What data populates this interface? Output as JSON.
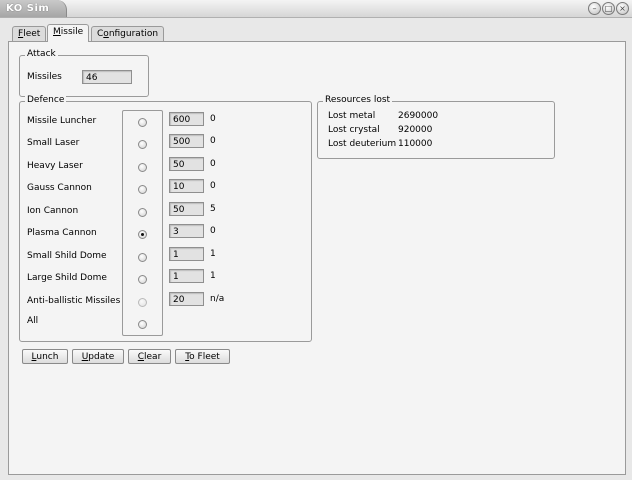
{
  "window": {
    "title": "KO Sim",
    "controls": [
      "minimize-icon",
      "maximize-icon",
      "close-icon"
    ]
  },
  "tabs": [
    {
      "label": "Fleet",
      "mnemonic": "F"
    },
    {
      "label": "Missile",
      "mnemonic": "M",
      "active": true
    },
    {
      "label": "Configuration",
      "mnemonic": "o"
    }
  ],
  "attack": {
    "legend": "Attack",
    "missiles_label": "Missiles",
    "missiles_value": "46"
  },
  "defence": {
    "legend": "Defence",
    "rows": [
      {
        "label": "Missile Luncher",
        "value": "600",
        "result": "0",
        "selected": false
      },
      {
        "label": "Small Laser",
        "value": "500",
        "result": "0",
        "selected": false
      },
      {
        "label": "Heavy Laser",
        "value": "50",
        "result": "0",
        "selected": false
      },
      {
        "label": "Gauss Cannon",
        "value": "10",
        "result": "0",
        "selected": false
      },
      {
        "label": "Ion Cannon",
        "value": "50",
        "result": "5",
        "selected": false
      },
      {
        "label": "Plasma Cannon",
        "value": "3",
        "result": "0",
        "selected": true
      },
      {
        "label": "Small Shild Dome",
        "value": "1",
        "result": "1",
        "selected": false
      },
      {
        "label": "Large Shild Dome",
        "value": "1",
        "result": "1",
        "selected": false
      },
      {
        "label": "Anti-ballistic Missiles",
        "value": "20",
        "result": "n/a",
        "selected": false,
        "disabled": true
      }
    ],
    "all_label": "All"
  },
  "resources": {
    "legend": "Resources lost",
    "rows": [
      {
        "label": "Lost metal",
        "value": "2690000"
      },
      {
        "label": "Lost crystal",
        "value": "920000"
      },
      {
        "label": "Lost deuterium",
        "value": "110000"
      }
    ]
  },
  "buttons": {
    "lunch": {
      "label": "Lunch",
      "mnemonic": "L"
    },
    "update": {
      "label": "Update",
      "mnemonic": "U"
    },
    "clear": {
      "label": "Clear",
      "mnemonic": "C"
    },
    "to_fleet": {
      "label": "To Fleet",
      "mnemonic": "T"
    }
  }
}
